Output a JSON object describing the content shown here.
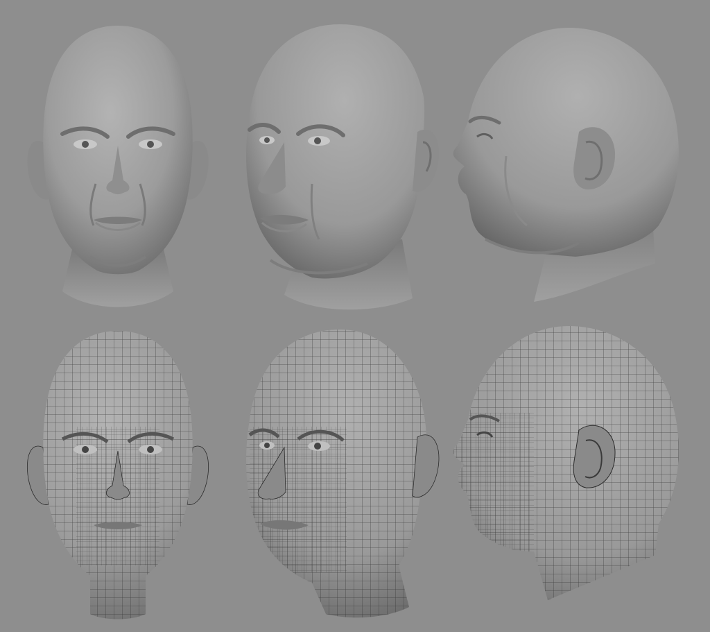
{
  "scene": {
    "background_color": "#8e8e8e",
    "clay_color": "#9a9a9a",
    "wire_color": "#2c2c2c",
    "rows": [
      {
        "label": "shaded",
        "views": [
          "front",
          "three-quarter",
          "profile"
        ],
        "wireframe": false
      },
      {
        "label": "wireframe",
        "views": [
          "front",
          "three-quarter",
          "profile"
        ],
        "wireframe": true
      }
    ]
  }
}
